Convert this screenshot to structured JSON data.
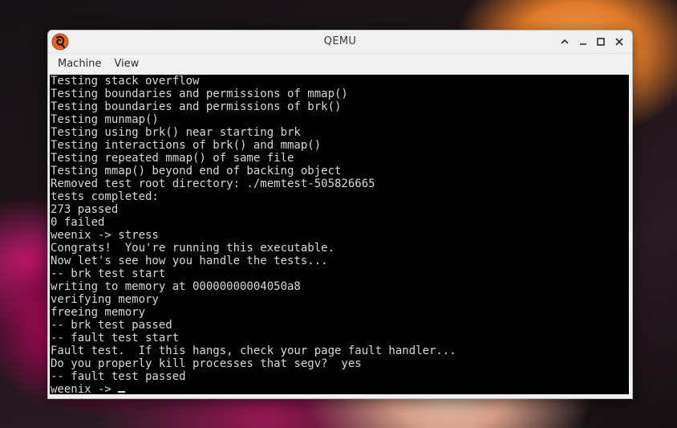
{
  "window": {
    "title": "QEMU",
    "app_icon": "qemu-logo-icon",
    "controls": [
      "shade-icon",
      "minimize-icon",
      "maximize-icon",
      "close-icon"
    ]
  },
  "menu": {
    "items": [
      {
        "label": "Machine"
      },
      {
        "label": "View"
      }
    ]
  },
  "console": {
    "lines": [
      "Testing stack overflow",
      "Testing boundaries and permissions of mmap()",
      "Testing boundaries and permissions of brk()",
      "Testing munmap()",
      "Testing using brk() near starting brk",
      "Testing interactions of brk() and mmap()",
      "Testing repeated mmap() of same file",
      "Testing mmap() beyond end of backing object",
      "Removed test root directory: ./memtest-505826665",
      "tests completed:",
      "273 passed",
      "0 failed",
      "weenix -> stress",
      "Congrats!  You're running this executable.",
      "Now let's see how you handle the tests...",
      "-- brk test start",
      "writing to memory at 00000000004050a8",
      "verifying memory",
      "freeing memory",
      "-- brk test passed",
      "-- fault test start",
      "Fault test.  If this hangs, check your page fault handler...",
      "Do you properly kill processes that segv?  yes",
      "-- fault test passed",
      "weenix -> "
    ]
  },
  "colors": {
    "console_bg": "#000000",
    "console_fg": "#d8d8d8",
    "window_bg": "#f2f2f2"
  }
}
